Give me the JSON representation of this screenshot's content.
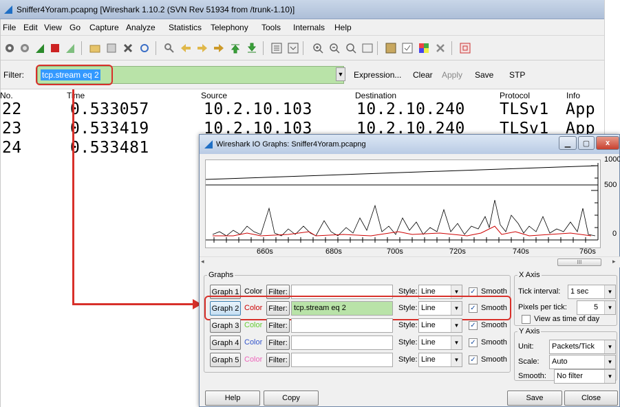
{
  "window": {
    "title": "Sniffer4Yoram.pcapng   [Wireshark 1.10.2  (SVN Rev 51934 from /trunk-1.10)]"
  },
  "menu": [
    "File",
    "Edit",
    "View",
    "Go",
    "Capture",
    "Analyze",
    "Statistics",
    "Telephony",
    "Tools",
    "Internals",
    "Help"
  ],
  "filter": {
    "label": "Filter:",
    "value": "tcp.stream eq 2",
    "buttons": [
      "Expression...",
      "Clear",
      "Apply",
      "Save",
      "STP"
    ]
  },
  "packet_list": {
    "columns": [
      "No.",
      "Time",
      "Source",
      "Destination",
      "Protocol",
      "Info"
    ],
    "rows": [
      {
        "no": "22",
        "time": "0.533057",
        "source": "10.2.10.103",
        "destination": "10.2.10.240",
        "protocol": "TLSv1",
        "info": "App"
      },
      {
        "no": "23",
        "time": "0.533419",
        "source": "10.2.10.103",
        "destination": "10.2.10.240",
        "protocol": "TLSv1",
        "info": "App"
      },
      {
        "no": "24",
        "time": "0.533481",
        "source": "",
        "destination": "",
        "protocol": "",
        "info": ""
      }
    ]
  },
  "io_dialog": {
    "title": "Wireshark IO Graphs: Sniffer4Yoram.pcapng",
    "plot": {
      "x_ticks": [
        "660s",
        "680s",
        "700s",
        "720s",
        "740s",
        "760s"
      ],
      "y_ticks": [
        "1000",
        "500",
        "0"
      ]
    },
    "graphs_label": "Graphs",
    "color_label": "Color",
    "filter_button": "Filter:",
    "style_label": "Style:",
    "smooth_label": "Smooth",
    "graphs": [
      {
        "name": "Graph 1",
        "filter": "",
        "style": "Line",
        "smooth": true,
        "color": "#000000"
      },
      {
        "name": "Graph 2",
        "filter": "tcp.stream eq 2",
        "style": "Line",
        "smooth": true,
        "color": "#cc0000"
      },
      {
        "name": "Graph 3",
        "filter": "",
        "style": "Line",
        "smooth": true,
        "color": "#66cc33"
      },
      {
        "name": "Graph 4",
        "filter": "",
        "style": "Line",
        "smooth": true,
        "color": "#3355cc"
      },
      {
        "name": "Graph 5",
        "filter": "",
        "style": "Line",
        "smooth": true,
        "color": "#ee66bb"
      }
    ],
    "x_axis": {
      "label": "X Axis",
      "tick_interval_label": "Tick interval:",
      "tick_interval": "1 sec",
      "pixels_per_tick_label": "Pixels per tick:",
      "pixels_per_tick": "5",
      "time_of_day_label": "View as time of day",
      "time_of_day": false
    },
    "y_axis": {
      "label": "Y Axis",
      "unit_label": "Unit:",
      "unit": "Packets/Tick",
      "scale_label": "Scale:",
      "scale": "Auto",
      "smooth_label": "Smooth:",
      "smooth": "No filter"
    },
    "buttons": {
      "help": "Help",
      "copy": "Copy",
      "save": "Save",
      "close": "Close"
    }
  }
}
